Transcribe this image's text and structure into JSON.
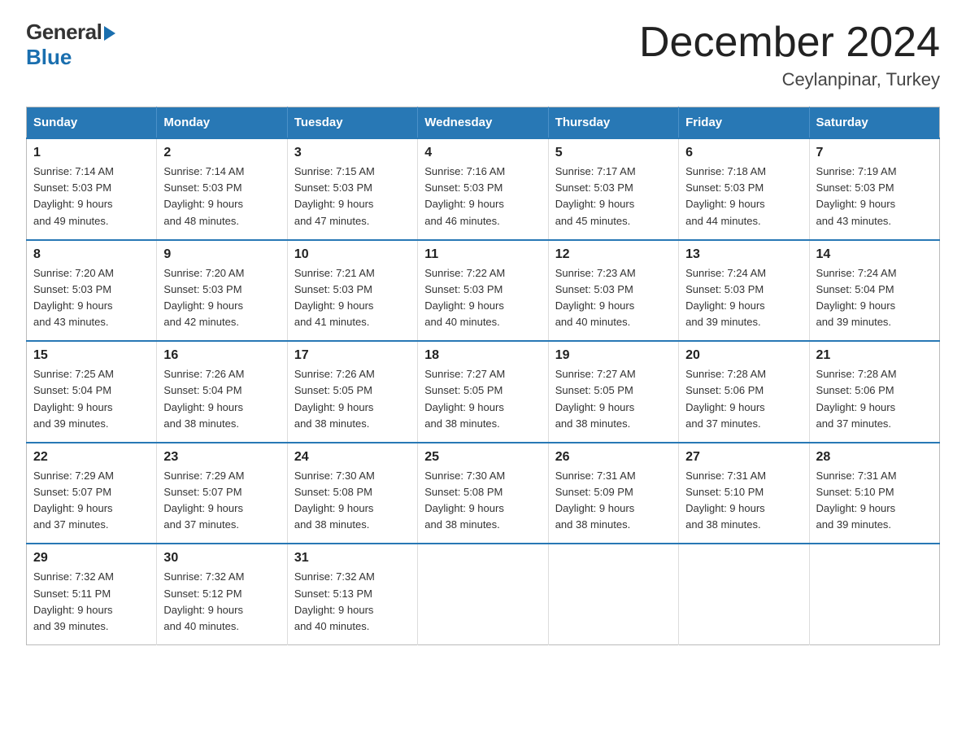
{
  "logo": {
    "general": "General",
    "blue": "Blue",
    "arrow": "▶"
  },
  "title": "December 2024",
  "subtitle": "Ceylanpinar, Turkey",
  "weekdays": [
    "Sunday",
    "Monday",
    "Tuesday",
    "Wednesday",
    "Thursday",
    "Friday",
    "Saturday"
  ],
  "weeks": [
    [
      {
        "day": "1",
        "sunrise": "7:14 AM",
        "sunset": "5:03 PM",
        "daylight": "9 hours and 49 minutes."
      },
      {
        "day": "2",
        "sunrise": "7:14 AM",
        "sunset": "5:03 PM",
        "daylight": "9 hours and 48 minutes."
      },
      {
        "day": "3",
        "sunrise": "7:15 AM",
        "sunset": "5:03 PM",
        "daylight": "9 hours and 47 minutes."
      },
      {
        "day": "4",
        "sunrise": "7:16 AM",
        "sunset": "5:03 PM",
        "daylight": "9 hours and 46 minutes."
      },
      {
        "day": "5",
        "sunrise": "7:17 AM",
        "sunset": "5:03 PM",
        "daylight": "9 hours and 45 minutes."
      },
      {
        "day": "6",
        "sunrise": "7:18 AM",
        "sunset": "5:03 PM",
        "daylight": "9 hours and 44 minutes."
      },
      {
        "day": "7",
        "sunrise": "7:19 AM",
        "sunset": "5:03 PM",
        "daylight": "9 hours and 43 minutes."
      }
    ],
    [
      {
        "day": "8",
        "sunrise": "7:20 AM",
        "sunset": "5:03 PM",
        "daylight": "9 hours and 43 minutes."
      },
      {
        "day": "9",
        "sunrise": "7:20 AM",
        "sunset": "5:03 PM",
        "daylight": "9 hours and 42 minutes."
      },
      {
        "day": "10",
        "sunrise": "7:21 AM",
        "sunset": "5:03 PM",
        "daylight": "9 hours and 41 minutes."
      },
      {
        "day": "11",
        "sunrise": "7:22 AM",
        "sunset": "5:03 PM",
        "daylight": "9 hours and 40 minutes."
      },
      {
        "day": "12",
        "sunrise": "7:23 AM",
        "sunset": "5:03 PM",
        "daylight": "9 hours and 40 minutes."
      },
      {
        "day": "13",
        "sunrise": "7:24 AM",
        "sunset": "5:03 PM",
        "daylight": "9 hours and 39 minutes."
      },
      {
        "day": "14",
        "sunrise": "7:24 AM",
        "sunset": "5:04 PM",
        "daylight": "9 hours and 39 minutes."
      }
    ],
    [
      {
        "day": "15",
        "sunrise": "7:25 AM",
        "sunset": "5:04 PM",
        "daylight": "9 hours and 39 minutes."
      },
      {
        "day": "16",
        "sunrise": "7:26 AM",
        "sunset": "5:04 PM",
        "daylight": "9 hours and 38 minutes."
      },
      {
        "day": "17",
        "sunrise": "7:26 AM",
        "sunset": "5:05 PM",
        "daylight": "9 hours and 38 minutes."
      },
      {
        "day": "18",
        "sunrise": "7:27 AM",
        "sunset": "5:05 PM",
        "daylight": "9 hours and 38 minutes."
      },
      {
        "day": "19",
        "sunrise": "7:27 AM",
        "sunset": "5:05 PM",
        "daylight": "9 hours and 38 minutes."
      },
      {
        "day": "20",
        "sunrise": "7:28 AM",
        "sunset": "5:06 PM",
        "daylight": "9 hours and 37 minutes."
      },
      {
        "day": "21",
        "sunrise": "7:28 AM",
        "sunset": "5:06 PM",
        "daylight": "9 hours and 37 minutes."
      }
    ],
    [
      {
        "day": "22",
        "sunrise": "7:29 AM",
        "sunset": "5:07 PM",
        "daylight": "9 hours and 37 minutes."
      },
      {
        "day": "23",
        "sunrise": "7:29 AM",
        "sunset": "5:07 PM",
        "daylight": "9 hours and 37 minutes."
      },
      {
        "day": "24",
        "sunrise": "7:30 AM",
        "sunset": "5:08 PM",
        "daylight": "9 hours and 38 minutes."
      },
      {
        "day": "25",
        "sunrise": "7:30 AM",
        "sunset": "5:08 PM",
        "daylight": "9 hours and 38 minutes."
      },
      {
        "day": "26",
        "sunrise": "7:31 AM",
        "sunset": "5:09 PM",
        "daylight": "9 hours and 38 minutes."
      },
      {
        "day": "27",
        "sunrise": "7:31 AM",
        "sunset": "5:10 PM",
        "daylight": "9 hours and 38 minutes."
      },
      {
        "day": "28",
        "sunrise": "7:31 AM",
        "sunset": "5:10 PM",
        "daylight": "9 hours and 39 minutes."
      }
    ],
    [
      {
        "day": "29",
        "sunrise": "7:32 AM",
        "sunset": "5:11 PM",
        "daylight": "9 hours and 39 minutes."
      },
      {
        "day": "30",
        "sunrise": "7:32 AM",
        "sunset": "5:12 PM",
        "daylight": "9 hours and 40 minutes."
      },
      {
        "day": "31",
        "sunrise": "7:32 AM",
        "sunset": "5:13 PM",
        "daylight": "9 hours and 40 minutes."
      },
      null,
      null,
      null,
      null
    ]
  ],
  "labels": {
    "sunrise": "Sunrise:",
    "sunset": "Sunset:",
    "daylight": "Daylight:"
  }
}
